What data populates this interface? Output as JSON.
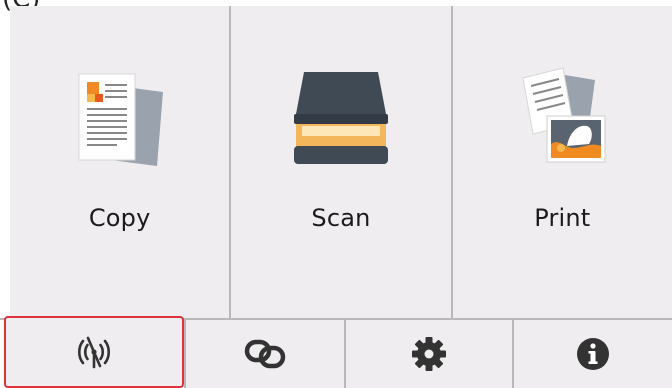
{
  "header": {
    "cutoff_text": "(C)"
  },
  "tiles": [
    {
      "label": "Copy",
      "icon": "copy-document-icon"
    },
    {
      "label": "Scan",
      "icon": "scanner-icon"
    },
    {
      "label": "Print",
      "icon": "print-photo-icon"
    }
  ],
  "toolbar": [
    {
      "icon": "wireless-off-icon",
      "selected": true
    },
    {
      "icon": "link-icon",
      "selected": false
    },
    {
      "icon": "gear-icon",
      "selected": false
    },
    {
      "icon": "info-icon",
      "selected": false
    }
  ],
  "colors": {
    "panel_bg": "#efedef",
    "divider": "#b9b7b9",
    "selection_border": "#e0323a",
    "icon_dark": "#333333"
  }
}
